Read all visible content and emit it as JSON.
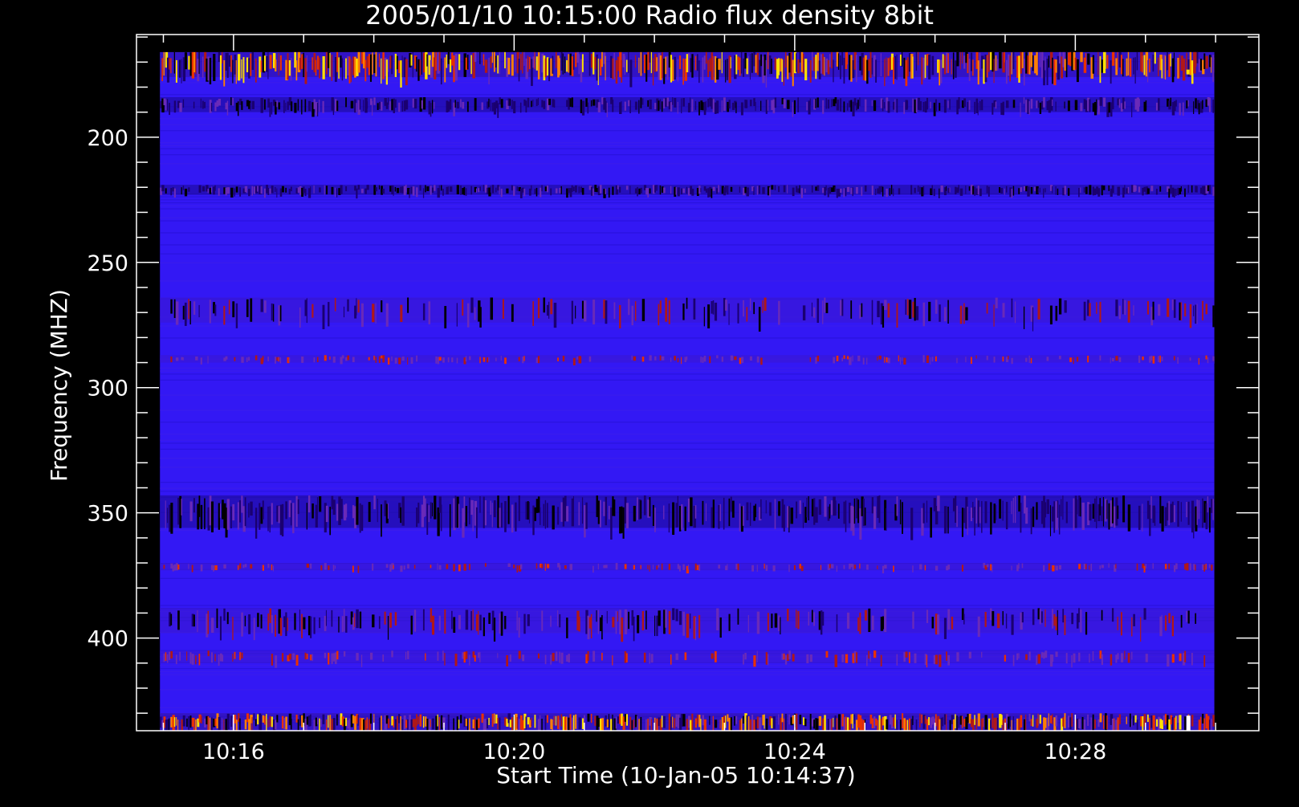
{
  "chart_data": {
    "type": "heatmap",
    "title": "2005/01/10 10:15:00 Radio flux density 8bit",
    "xlabel": "Start Time (10-Jan-05 10:14:37)",
    "ylabel": "Frequency (MHZ)",
    "xlim": [
      "10:14:37",
      "10:30:37"
    ],
    "ylim": [
      437,
      159
    ],
    "y_reversed": true,
    "data_range": {
      "x": [
        "10:14:57",
        "10:29:59"
      ],
      "y": [
        166,
        446
      ]
    },
    "x_ticks": [
      "10:16",
      "10:20",
      "10:24",
      "10:28"
    ],
    "y_ticks": [
      200,
      250,
      300,
      350,
      400
    ],
    "x_minor_tick_step_min": 1,
    "y_minor_tick_step_mhz": 10,
    "colormap": [
      "#000000",
      "#1a0070",
      "#2a10e8",
      "#3a1aff",
      "#6a2ab8",
      "#b01818",
      "#e83000",
      "#ff8000",
      "#ffe000",
      "#ffffff"
    ],
    "background_color": "#3318f4",
    "bands": [
      {
        "freq_mhz": [
          165,
          176
        ],
        "intensity": "high",
        "description": "broadband interference with bright yellow/red spikes"
      },
      {
        "freq_mhz": [
          184,
          190
        ],
        "intensity": "low",
        "description": "dark band"
      },
      {
        "freq_mhz": [
          219,
          223
        ],
        "intensity": "low",
        "description": "dark band"
      },
      {
        "freq_mhz": [
          264,
          274
        ],
        "intensity": "mixed"
      },
      {
        "freq_mhz": [
          287,
          290
        ],
        "intensity": "medium",
        "description": "red/orange emission spots"
      },
      {
        "freq_mhz": [
          343,
          356
        ],
        "intensity": "low",
        "description": "dark vertical-stripe band"
      },
      {
        "freq_mhz": [
          370,
          373
        ],
        "intensity": "medium"
      },
      {
        "freq_mhz": [
          388,
          398
        ],
        "intensity": "mixed"
      },
      {
        "freq_mhz": [
          405,
          410
        ],
        "intensity": "medium"
      },
      {
        "freq_mhz": [
          430,
          437
        ],
        "intensity": "high",
        "description": "red stripes with bright spots near 10:29:30"
      }
    ]
  }
}
